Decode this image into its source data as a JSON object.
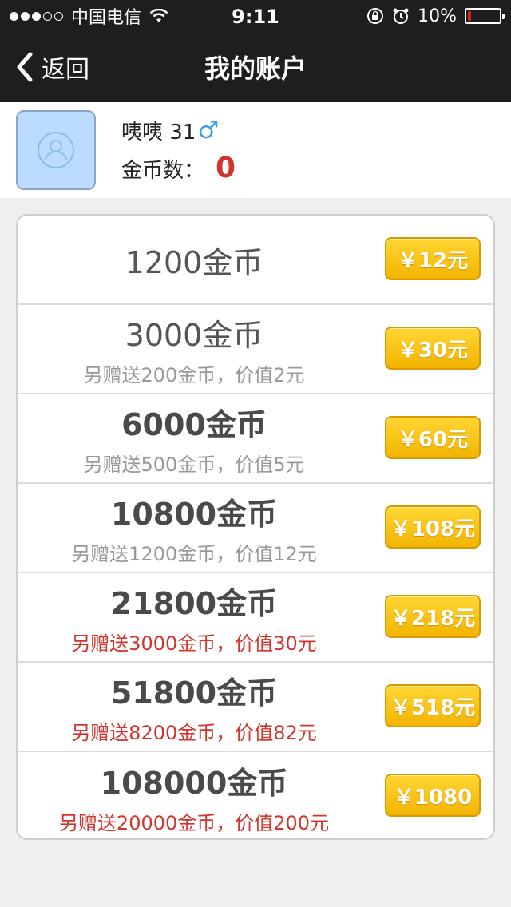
{
  "status_bar": {
    "carrier": "中国电信",
    "time": "9:11",
    "battery": "10%",
    "battery_level": 0.1
  },
  "nav": {
    "back_label": "返回",
    "title": "我的账户"
  },
  "profile": {
    "name": "咦咦 31",
    "gender_symbol": "♂",
    "coin_label": "金币数：",
    "coin_count": "0"
  },
  "packages": [
    {
      "amount": "1200金币",
      "bonus": "",
      "price": "￥12元",
      "bold": false,
      "bonus_red": false
    },
    {
      "amount": "3000金币",
      "bonus": "另赠送200金币，价值2元",
      "price": "￥30元",
      "bold": false,
      "bonus_red": false
    },
    {
      "amount": "6000金币",
      "bonus": "另赠送500金币，价值5元",
      "price": "￥60元",
      "bold": true,
      "bonus_red": false
    },
    {
      "amount": "10800金币",
      "bonus": "另赠送1200金币，价值12元",
      "price": "￥108元",
      "bold": true,
      "bonus_red": false
    },
    {
      "amount": "21800金币",
      "bonus": "另赠送3000金币，价值30元",
      "price": "￥218元",
      "bold": true,
      "bonus_red": true
    },
    {
      "amount": "51800金币",
      "bonus": "另赠送8200金币，价值82元",
      "price": "￥518元",
      "bold": true,
      "bonus_red": true
    },
    {
      "amount": "108000金币",
      "bonus": "另赠送20000金币，价值200元",
      "price": "￥1080",
      "bold": true,
      "bonus_red": true
    }
  ],
  "colors": {
    "nav_bg": "#1e1e1e",
    "accent_red": "#d0342c",
    "button_yellow": "#f3b400",
    "male_blue": "#3aa0e8"
  }
}
